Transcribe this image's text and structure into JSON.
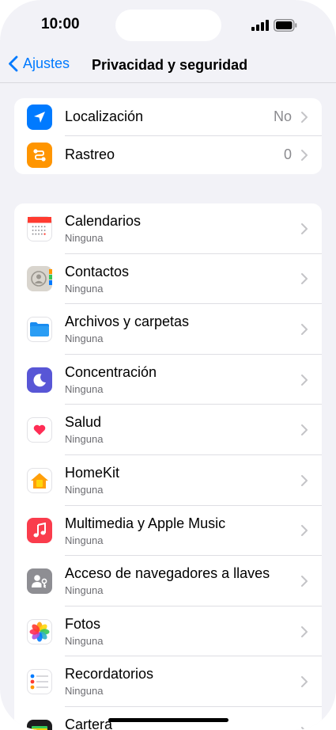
{
  "status": {
    "time": "10:00"
  },
  "nav": {
    "back_label": "Ajustes",
    "title": "Privacidad y seguridad"
  },
  "group1": [
    {
      "label": "Localización",
      "value": "No",
      "icon": "location-arrow-icon",
      "color": "#007aff"
    },
    {
      "label": "Rastreo",
      "value": "0",
      "icon": "tracking-icon",
      "color": "#ff9500"
    }
  ],
  "group2": [
    {
      "label": "Calendarios",
      "sub": "Ninguna",
      "icon": "calendar-icon"
    },
    {
      "label": "Contactos",
      "sub": "Ninguna",
      "icon": "contacts-icon"
    },
    {
      "label": "Archivos y carpetas",
      "sub": "Ninguna",
      "icon": "folder-icon"
    },
    {
      "label": "Concentración",
      "sub": "Ninguna",
      "icon": "moon-icon"
    },
    {
      "label": "Salud",
      "sub": "Ninguna",
      "icon": "heart-icon"
    },
    {
      "label": "HomeKit",
      "sub": "Ninguna",
      "icon": "home-icon"
    },
    {
      "label": "Multimedia y Apple Music",
      "sub": "Ninguna",
      "icon": "music-note-icon"
    },
    {
      "label": "Acceso de navegadores a llaves",
      "sub": "Ninguna",
      "icon": "passkey-icon"
    },
    {
      "label": "Fotos",
      "sub": "Ninguna",
      "icon": "photos-icon"
    },
    {
      "label": "Recordatorios",
      "sub": "Ninguna",
      "icon": "reminders-icon"
    },
    {
      "label": "Cartera",
      "sub": "",
      "icon": "wallet-icon"
    }
  ]
}
